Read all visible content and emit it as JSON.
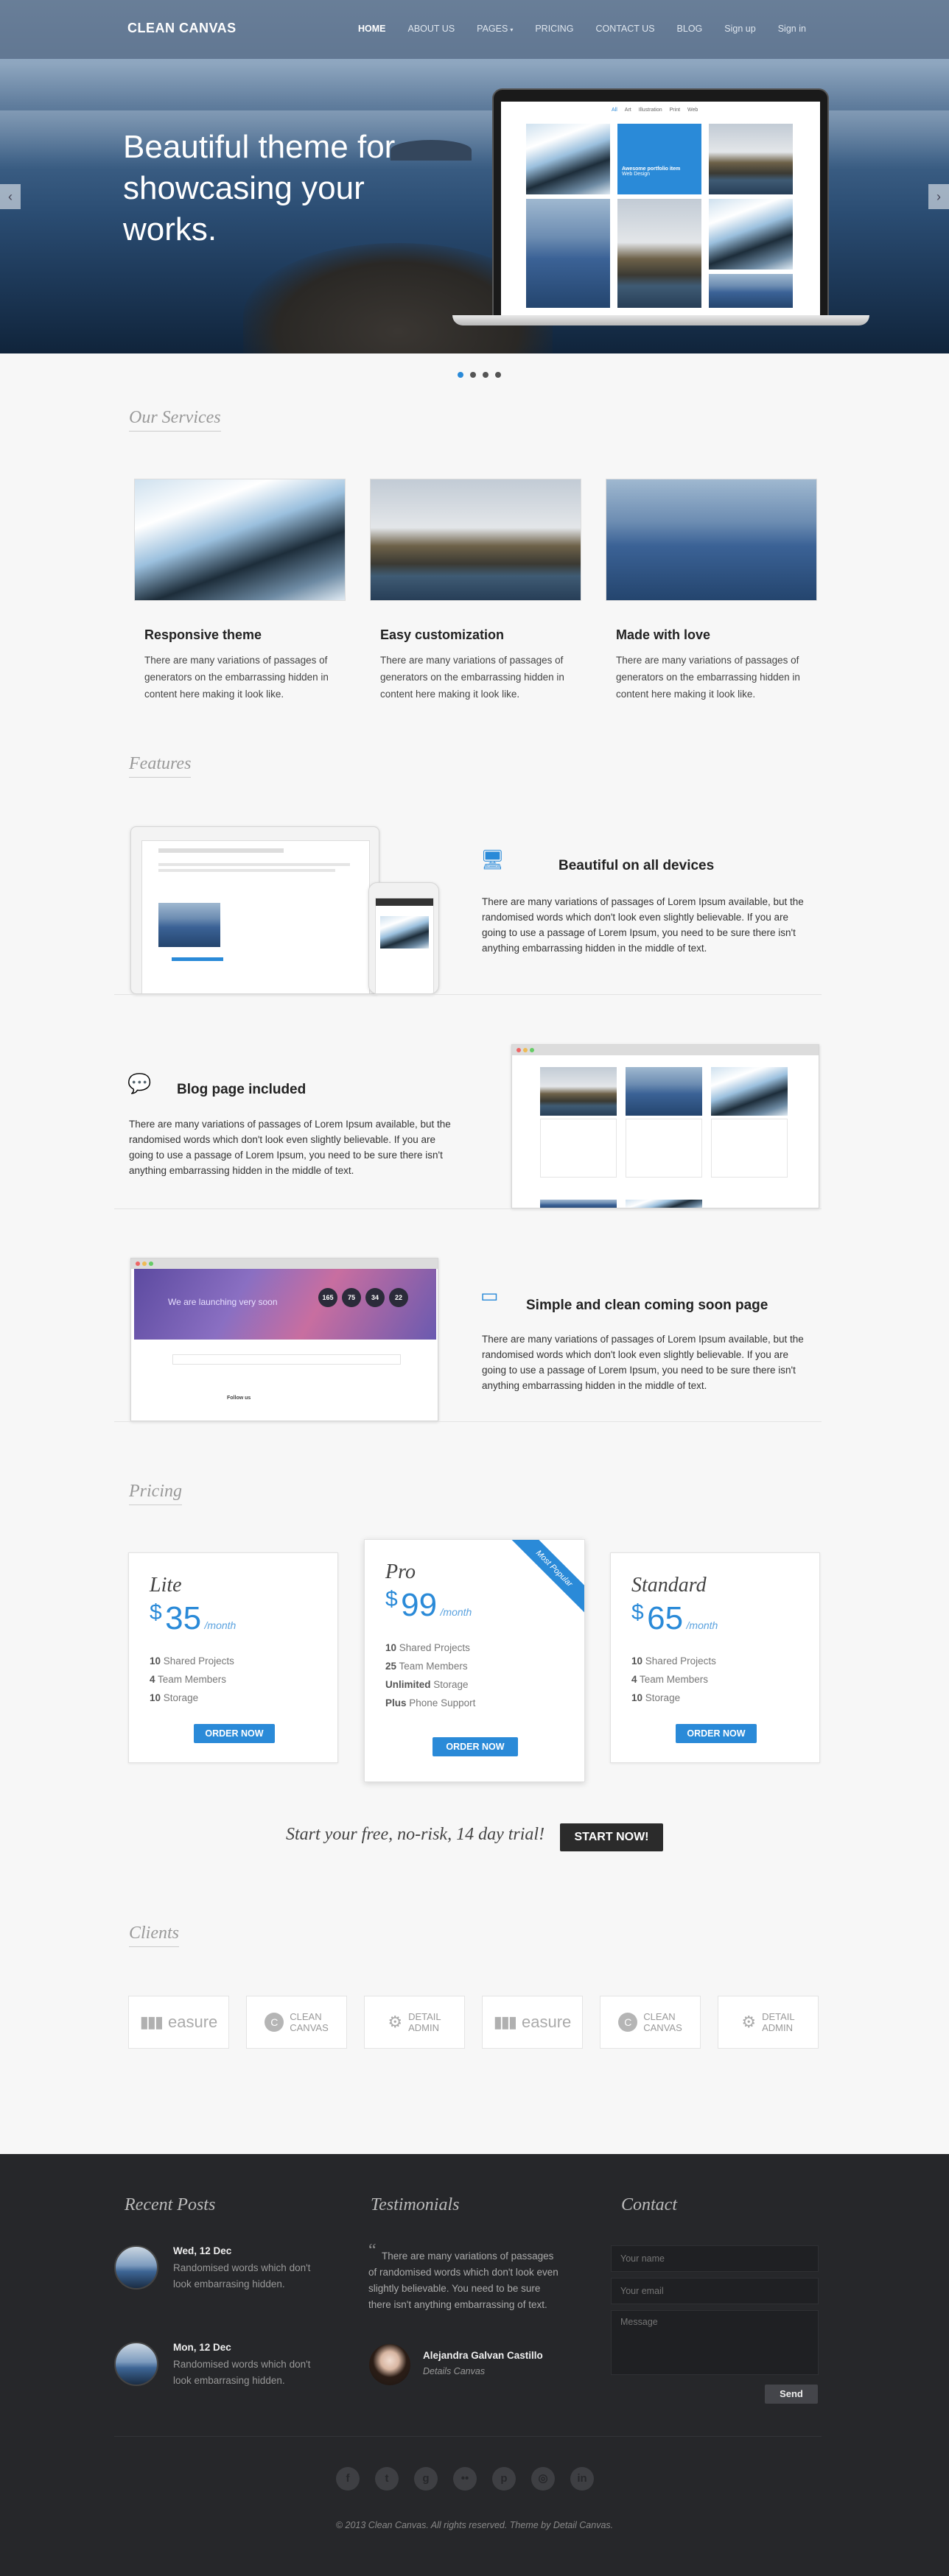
{
  "header": {
    "logo": "CLEAN CANVAS",
    "nav": [
      "HOME",
      "ABOUT US",
      "PAGES",
      "PRICING",
      "CONTACT US",
      "BLOG",
      "Sign up",
      "Sign in"
    ],
    "active": "HOME"
  },
  "hero": {
    "title": "Beautiful theme for showcasing your works.",
    "prev_icon": "chevron-left-icon",
    "next_icon": "chevron-right-icon",
    "laptop": {
      "tabs": [
        "All",
        "Art",
        "Illustration",
        "Print",
        "Web"
      ],
      "feature_title": "Awesome portfolio item",
      "feature_sub": "Web Design"
    },
    "dots": 4,
    "active_dot": 1
  },
  "services": {
    "title": "Our Services",
    "items": [
      {
        "title": "Responsive theme",
        "text": "There are many variations of passages of generators on the embarrassing hidden in content here making it look like."
      },
      {
        "title": "Easy customization",
        "text": "There are many variations of passages of generators on the embarrassing hidden in content here making it look like."
      },
      {
        "title": "Made with love",
        "text": "There are many variations of passages of generators on the embarrassing hidden in content here making it look like."
      }
    ]
  },
  "features": {
    "title": "Features",
    "items": [
      {
        "title": "Beautiful on all devices",
        "icon": "devices-icon",
        "text": "There are many variations of passages of Lorem Ipsum available, but the randomised words which don't look even slightly believable. If you are going to use a passage of Lorem Ipsum, you need to be sure there isn't anything embarrassing hidden in the middle of text."
      },
      {
        "title": "Blog page included",
        "icon": "chat-bubbles-icon",
        "text": "There are many variations of passages of Lorem Ipsum available, but the randomised words which don't look even slightly believable. If you are going to use a passage of Lorem Ipsum, you need to be sure there isn't anything embarrassing hidden in the middle of text."
      },
      {
        "title": "Simple and clean coming soon page",
        "icon": "browser-window-icon",
        "text": "There are many variations of passages of Lorem Ipsum available, but the randomised words which don't look even slightly believable. If you are going to use a passage of Lorem Ipsum, you need to be sure there isn't anything embarrassing hidden in the middle of text."
      }
    ],
    "coming_soon": {
      "headline": "We are launching very soon",
      "counters": [
        "165",
        "75",
        "34",
        "22"
      ],
      "follow": "Follow us"
    }
  },
  "pricing": {
    "title": "Pricing",
    "currency": "$",
    "per": "/month",
    "plans": [
      {
        "name": "Lite",
        "price": "35",
        "features": [
          [
            "10",
            "Shared Projects"
          ],
          [
            "4",
            "Team Members"
          ],
          [
            "10",
            "Storage"
          ]
        ],
        "button": "ORDER NOW"
      },
      {
        "name": "Pro",
        "price": "99",
        "ribbon": "Most Popular",
        "features": [
          [
            "10",
            "Shared Projects"
          ],
          [
            "25",
            "Team Members"
          ],
          [
            "Unlimited",
            "Storage"
          ],
          [
            "Plus",
            "Phone Support"
          ]
        ],
        "button": "ORDER NOW"
      },
      {
        "name": "Standard",
        "price": "65",
        "features": [
          [
            "10",
            "Shared Projects"
          ],
          [
            "4",
            "Team Members"
          ],
          [
            "10",
            "Storage"
          ]
        ],
        "button": "ORDER NOW"
      }
    ],
    "trial_text": "Start your free, no-risk, 14 day trial!",
    "trial_button": "START NOW!"
  },
  "clients": {
    "title": "Clients",
    "logos": [
      {
        "type": "easure",
        "text": "easure"
      },
      {
        "type": "canvas",
        "top": "CLEAN",
        "bottom": "CANVAS"
      },
      {
        "type": "admin",
        "top": "DETAIL",
        "bottom": "ADMIN"
      },
      {
        "type": "easure",
        "text": "easure"
      },
      {
        "type": "canvas",
        "top": "CLEAN",
        "bottom": "CANVAS"
      },
      {
        "type": "admin",
        "top": "DETAIL",
        "bottom": "ADMIN"
      }
    ]
  },
  "footer": {
    "recent_title": "Recent Posts",
    "posts": [
      {
        "date": "Wed, 12 Dec",
        "text": "Randomised words which don't look embarrasing hidden."
      },
      {
        "date": "Mon, 12 Dec",
        "text": "Randomised words which don't look embarrasing hidden."
      }
    ],
    "testimonials_title": "Testimonials",
    "quote": "There are many variations of passages of randomised words which don't look even slightly believable. You need to be sure there isn't anything embarrassing of text.",
    "testimonial_name": "Alejandra Galvan Castillo",
    "testimonial_company": "Details Canvas",
    "contact_title": "Contact",
    "name_placeholder": "Your name",
    "email_placeholder": "Your email",
    "message_placeholder": "Message",
    "send": "Send",
    "social": [
      "facebook-icon",
      "twitter-icon",
      "google-plus-icon",
      "flickr-icon",
      "pinterest-icon",
      "dribbble-icon",
      "linkedin-icon"
    ],
    "copyright": "© 2013 Clean Canvas. All rights reserved. Theme by Detail Canvas."
  }
}
